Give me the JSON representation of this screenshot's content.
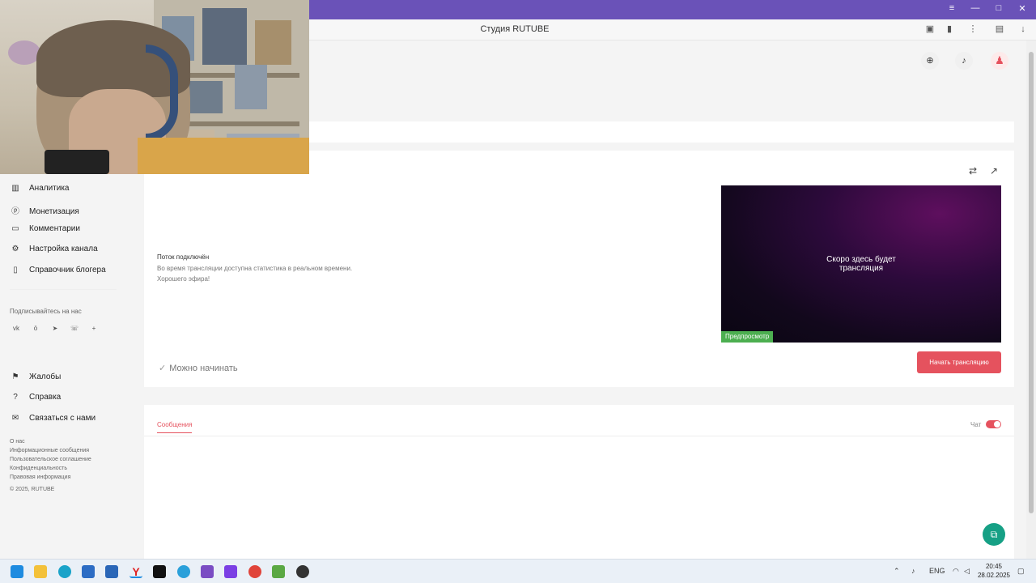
{
  "browser": {
    "tab_title": "Студия RUTUBE",
    "window_controls": [
      "—",
      "□",
      "✕"
    ],
    "window_min_label": "—",
    "window_max_label": "□",
    "window_close_label": "✕"
  },
  "sidebar": {
    "items": [
      {
        "label": "Аналитика",
        "icon": "analytics-icon"
      },
      {
        "label": "Монетизация",
        "icon": "monetization-icon"
      },
      {
        "label": "Комментарии",
        "icon": "comments-icon"
      },
      {
        "label": "Настройка канала",
        "icon": "settings-icon"
      },
      {
        "label": "Справочник блогера",
        "icon": "book-icon"
      }
    ],
    "follow_label": "Подписывайтесь на нас",
    "socials": [
      "vk-icon",
      "ok-icon",
      "telegram-icon",
      "viber-icon",
      "plus-icon"
    ],
    "support_items": [
      {
        "label": "Жалобы",
        "icon": "flag-icon"
      },
      {
        "label": "Справка",
        "icon": "help-icon"
      },
      {
        "label": "Связаться с нами",
        "icon": "mail-icon"
      }
    ],
    "footer_links": [
      "О нас",
      "Информационные сообщения",
      "Пользовательское соглашение",
      "Конфиденциальность",
      "Правовая информация"
    ],
    "copyright": "© 2025, RUTUBE"
  },
  "stream": {
    "status_title": "Поток подключён",
    "status_line1": "Во время трансляции доступна статистика в реальном времени.",
    "status_line2": "Хорошего эфира!",
    "preview_text_line1": "Скоро здесь будет",
    "preview_text_line2": "трансляция",
    "preview_badge": "Предпросмотр",
    "ready_text": "Можно начинать",
    "start_button": "Начать трансляцию"
  },
  "chat": {
    "tab_messages": "Сообщения",
    "toggle_label": "Чат",
    "toggle_on": true
  },
  "taskbar": {
    "lang": "ENG",
    "time": "20:45",
    "date": "28.02.2025"
  },
  "colors": {
    "accent": "#e5525e",
    "titlebar": "#6a52b8",
    "preview_badge": "#4caf50",
    "fab": "#16a085"
  }
}
